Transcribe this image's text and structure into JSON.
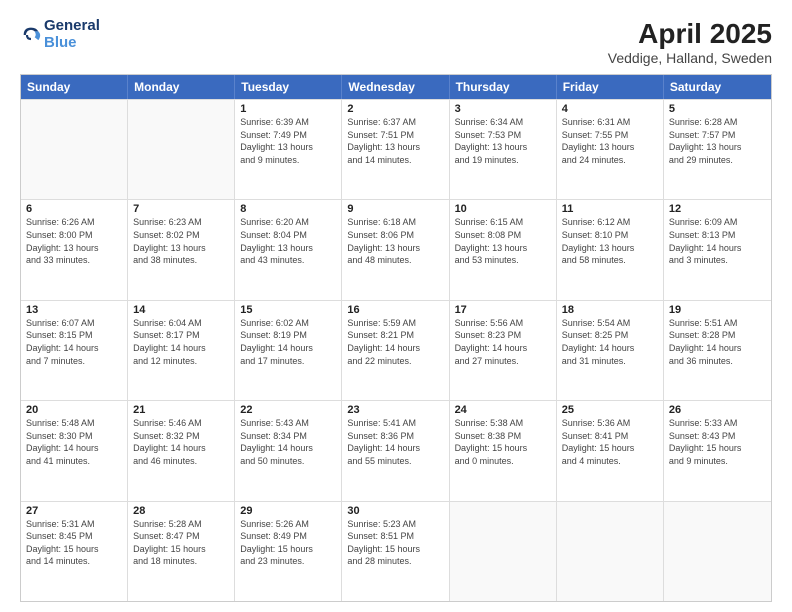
{
  "logo": {
    "line1": "General",
    "line2": "Blue"
  },
  "title": "April 2025",
  "subtitle": "Veddige, Halland, Sweden",
  "header": {
    "days": [
      "Sunday",
      "Monday",
      "Tuesday",
      "Wednesday",
      "Thursday",
      "Friday",
      "Saturday"
    ]
  },
  "weeks": [
    [
      {
        "day": "",
        "info": ""
      },
      {
        "day": "",
        "info": ""
      },
      {
        "day": "1",
        "info": "Sunrise: 6:39 AM\nSunset: 7:49 PM\nDaylight: 13 hours\nand 9 minutes."
      },
      {
        "day": "2",
        "info": "Sunrise: 6:37 AM\nSunset: 7:51 PM\nDaylight: 13 hours\nand 14 minutes."
      },
      {
        "day": "3",
        "info": "Sunrise: 6:34 AM\nSunset: 7:53 PM\nDaylight: 13 hours\nand 19 minutes."
      },
      {
        "day": "4",
        "info": "Sunrise: 6:31 AM\nSunset: 7:55 PM\nDaylight: 13 hours\nand 24 minutes."
      },
      {
        "day": "5",
        "info": "Sunrise: 6:28 AM\nSunset: 7:57 PM\nDaylight: 13 hours\nand 29 minutes."
      }
    ],
    [
      {
        "day": "6",
        "info": "Sunrise: 6:26 AM\nSunset: 8:00 PM\nDaylight: 13 hours\nand 33 minutes."
      },
      {
        "day": "7",
        "info": "Sunrise: 6:23 AM\nSunset: 8:02 PM\nDaylight: 13 hours\nand 38 minutes."
      },
      {
        "day": "8",
        "info": "Sunrise: 6:20 AM\nSunset: 8:04 PM\nDaylight: 13 hours\nand 43 minutes."
      },
      {
        "day": "9",
        "info": "Sunrise: 6:18 AM\nSunset: 8:06 PM\nDaylight: 13 hours\nand 48 minutes."
      },
      {
        "day": "10",
        "info": "Sunrise: 6:15 AM\nSunset: 8:08 PM\nDaylight: 13 hours\nand 53 minutes."
      },
      {
        "day": "11",
        "info": "Sunrise: 6:12 AM\nSunset: 8:10 PM\nDaylight: 13 hours\nand 58 minutes."
      },
      {
        "day": "12",
        "info": "Sunrise: 6:09 AM\nSunset: 8:13 PM\nDaylight: 14 hours\nand 3 minutes."
      }
    ],
    [
      {
        "day": "13",
        "info": "Sunrise: 6:07 AM\nSunset: 8:15 PM\nDaylight: 14 hours\nand 7 minutes."
      },
      {
        "day": "14",
        "info": "Sunrise: 6:04 AM\nSunset: 8:17 PM\nDaylight: 14 hours\nand 12 minutes."
      },
      {
        "day": "15",
        "info": "Sunrise: 6:02 AM\nSunset: 8:19 PM\nDaylight: 14 hours\nand 17 minutes."
      },
      {
        "day": "16",
        "info": "Sunrise: 5:59 AM\nSunset: 8:21 PM\nDaylight: 14 hours\nand 22 minutes."
      },
      {
        "day": "17",
        "info": "Sunrise: 5:56 AM\nSunset: 8:23 PM\nDaylight: 14 hours\nand 27 minutes."
      },
      {
        "day": "18",
        "info": "Sunrise: 5:54 AM\nSunset: 8:25 PM\nDaylight: 14 hours\nand 31 minutes."
      },
      {
        "day": "19",
        "info": "Sunrise: 5:51 AM\nSunset: 8:28 PM\nDaylight: 14 hours\nand 36 minutes."
      }
    ],
    [
      {
        "day": "20",
        "info": "Sunrise: 5:48 AM\nSunset: 8:30 PM\nDaylight: 14 hours\nand 41 minutes."
      },
      {
        "day": "21",
        "info": "Sunrise: 5:46 AM\nSunset: 8:32 PM\nDaylight: 14 hours\nand 46 minutes."
      },
      {
        "day": "22",
        "info": "Sunrise: 5:43 AM\nSunset: 8:34 PM\nDaylight: 14 hours\nand 50 minutes."
      },
      {
        "day": "23",
        "info": "Sunrise: 5:41 AM\nSunset: 8:36 PM\nDaylight: 14 hours\nand 55 minutes."
      },
      {
        "day": "24",
        "info": "Sunrise: 5:38 AM\nSunset: 8:38 PM\nDaylight: 15 hours\nand 0 minutes."
      },
      {
        "day": "25",
        "info": "Sunrise: 5:36 AM\nSunset: 8:41 PM\nDaylight: 15 hours\nand 4 minutes."
      },
      {
        "day": "26",
        "info": "Sunrise: 5:33 AM\nSunset: 8:43 PM\nDaylight: 15 hours\nand 9 minutes."
      }
    ],
    [
      {
        "day": "27",
        "info": "Sunrise: 5:31 AM\nSunset: 8:45 PM\nDaylight: 15 hours\nand 14 minutes."
      },
      {
        "day": "28",
        "info": "Sunrise: 5:28 AM\nSunset: 8:47 PM\nDaylight: 15 hours\nand 18 minutes."
      },
      {
        "day": "29",
        "info": "Sunrise: 5:26 AM\nSunset: 8:49 PM\nDaylight: 15 hours\nand 23 minutes."
      },
      {
        "day": "30",
        "info": "Sunrise: 5:23 AM\nSunset: 8:51 PM\nDaylight: 15 hours\nand 28 minutes."
      },
      {
        "day": "",
        "info": ""
      },
      {
        "day": "",
        "info": ""
      },
      {
        "day": "",
        "info": ""
      }
    ]
  ]
}
